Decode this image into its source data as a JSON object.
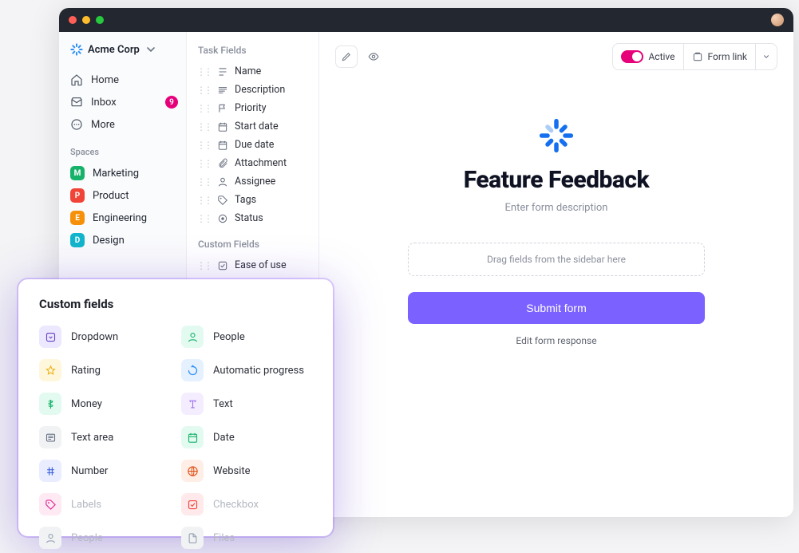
{
  "workspace": {
    "name": "Acme Corp"
  },
  "nav": {
    "home": "Home",
    "inbox": "Inbox",
    "inbox_count": "9",
    "more": "More"
  },
  "spaces": {
    "header": "Spaces",
    "items": [
      {
        "initial": "M",
        "label": "Marketing",
        "bg": "#17b26a"
      },
      {
        "initial": "P",
        "label": "Product",
        "bg": "#f04438"
      },
      {
        "initial": "E",
        "label": "Engineering",
        "bg": "#f79009"
      },
      {
        "initial": "D",
        "label": "Design",
        "bg": "#12b5cb"
      }
    ]
  },
  "task_fields": {
    "header": "Task Fields",
    "items": [
      {
        "label": "Name",
        "icon": "name"
      },
      {
        "label": "Description",
        "icon": "description"
      },
      {
        "label": "Priority",
        "icon": "priority"
      },
      {
        "label": "Start date",
        "icon": "start-date"
      },
      {
        "label": "Due date",
        "icon": "due-date"
      },
      {
        "label": "Attachment",
        "icon": "attachment"
      },
      {
        "label": "Assignee",
        "icon": "assignee"
      },
      {
        "label": "Tags",
        "icon": "tags"
      },
      {
        "label": "Status",
        "icon": "status"
      }
    ]
  },
  "custom_fields_list": {
    "header": "Custom Fields",
    "items": [
      {
        "label": "Ease of use",
        "icon": "checkbox"
      }
    ]
  },
  "toolbar": {
    "active_label": "Active",
    "form_link_label": "Form link"
  },
  "form": {
    "title": "Feature Feedback",
    "description": "Enter form description",
    "dropzone_hint": "Drag fields from the sidebar here",
    "submit_label": "Submit form",
    "edit_response_label": "Edit form response"
  },
  "custom_fields_panel": {
    "title": "Custom fields",
    "items": [
      {
        "label": "Dropdown",
        "color": "#ece8ff",
        "fg": "#6941c6",
        "icon": "dropdown"
      },
      {
        "label": "People",
        "color": "#e3faf0",
        "fg": "#17b26a",
        "icon": "people"
      },
      {
        "label": "Rating",
        "color": "#fff7db",
        "fg": "#eaaa08",
        "icon": "star"
      },
      {
        "label": "Automatic progress",
        "color": "#e6f1ff",
        "fg": "#2e90fa",
        "icon": "progress"
      },
      {
        "label": "Money",
        "color": "#e3faf0",
        "fg": "#17b26a",
        "icon": "money"
      },
      {
        "label": "Text",
        "color": "#f4ecff",
        "fg": "#9e77ed",
        "icon": "text"
      },
      {
        "label": "Text area",
        "color": "#f1f2f4",
        "fg": "#667085",
        "icon": "textarea"
      },
      {
        "label": "Date",
        "color": "#e3faf0",
        "fg": "#17b26a",
        "icon": "date"
      },
      {
        "label": "Number",
        "color": "#e9edff",
        "fg": "#3e63dd",
        "icon": "number"
      },
      {
        "label": "Website",
        "color": "#ffeee6",
        "fg": "#e04f16",
        "icon": "website"
      },
      {
        "label": "Labels",
        "color": "#ffe9f3",
        "fg": "#dd2590",
        "icon": "labels",
        "dim": true
      },
      {
        "label": "Checkbox",
        "color": "#ffe9ea",
        "fg": "#f04438",
        "icon": "checkbox",
        "dim": true
      },
      {
        "label": "People",
        "color": "#f1f2f4",
        "fg": "#98a2b3",
        "icon": "people",
        "dim": true
      },
      {
        "label": "Files",
        "color": "#f1f2f4",
        "fg": "#98a2b3",
        "icon": "files",
        "dim": true
      }
    ]
  }
}
